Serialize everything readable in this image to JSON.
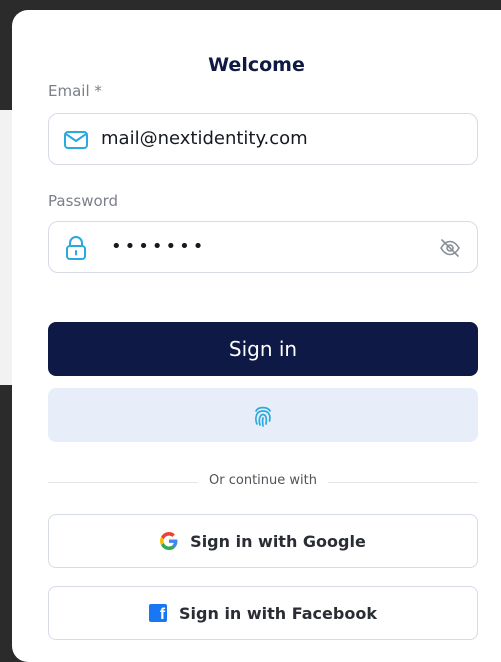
{
  "title": "Welcome",
  "email": {
    "label": "Email *",
    "value": "mail@nextidentity.com",
    "icon": "mail-icon"
  },
  "password": {
    "label": "Password",
    "value": "•••••••",
    "icon": "lock-icon",
    "toggle_icon": "eye-off-icon"
  },
  "sign_in_label": "Sign in",
  "biometric_icon": "fingerprint-icon",
  "divider_text": "Or continue with",
  "google": {
    "label": "Sign in with Google",
    "icon": "google-icon"
  },
  "facebook": {
    "label": "Sign in with Facebook",
    "icon": "facebook-icon"
  },
  "colors": {
    "primary": "#0e1a45",
    "accent": "#29a9e0",
    "biometric_bg": "#e7eefa",
    "google_blue": "#4285f4",
    "facebook_blue": "#1877f2"
  }
}
